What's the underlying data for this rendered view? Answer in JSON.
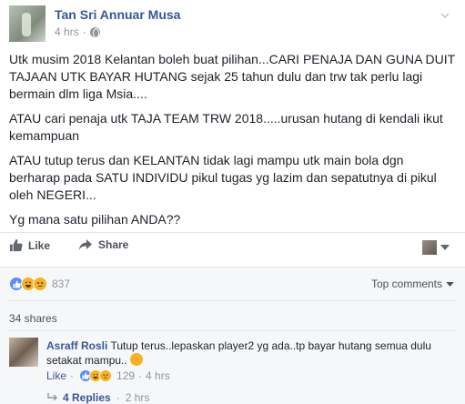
{
  "post": {
    "author": "Tan Sri Annuar Musa",
    "time": "4 hrs",
    "dot": "·",
    "paragraphs": [
      "Utk musim 2018 Kelantan boleh buat pilihan...CARI PENAJA DAN GUNA DUIT TAJAAN UTK BAYAR HUTANG sejak 25 tahun dulu dan trw tak perlu lagi bermain dlm liga Msia....",
      "ATAU cari penaja utk TAJA TEAM TRW 2018.....urusan hutang di kendali ikut kemampuan",
      "ATAU tutup terus dan KELANTAN tidak lagi mampu utk main bola dgn berharap pada SATU INDIVIDU pikul tugas yg lazim dan sepatutnya di pikul oleh NEGERI...",
      "Yg mana satu pilihan ANDA??"
    ]
  },
  "actions": {
    "like_label": "Like",
    "share_label": "Share"
  },
  "summary": {
    "reaction_count": "837",
    "top_comments_label": "Top comments",
    "shares_label": "34 shares"
  },
  "comment": {
    "name": "Asraff Rosli",
    "text": "Tutup terus..lepaskan player2 yg ada..tp bayar hutang semua dulu setakat mampu..",
    "like_label": "Like",
    "dot": "·",
    "reaction_count": "129",
    "time": "4 hrs"
  },
  "replies": {
    "label": "4 Replies",
    "dot": "·",
    "time": "2 hrs"
  },
  "colors": {
    "link_blue": "#365899",
    "like_blue": "#5890ff",
    "haha_yellow": "#f7b125",
    "meta_grey": "#90949c"
  }
}
